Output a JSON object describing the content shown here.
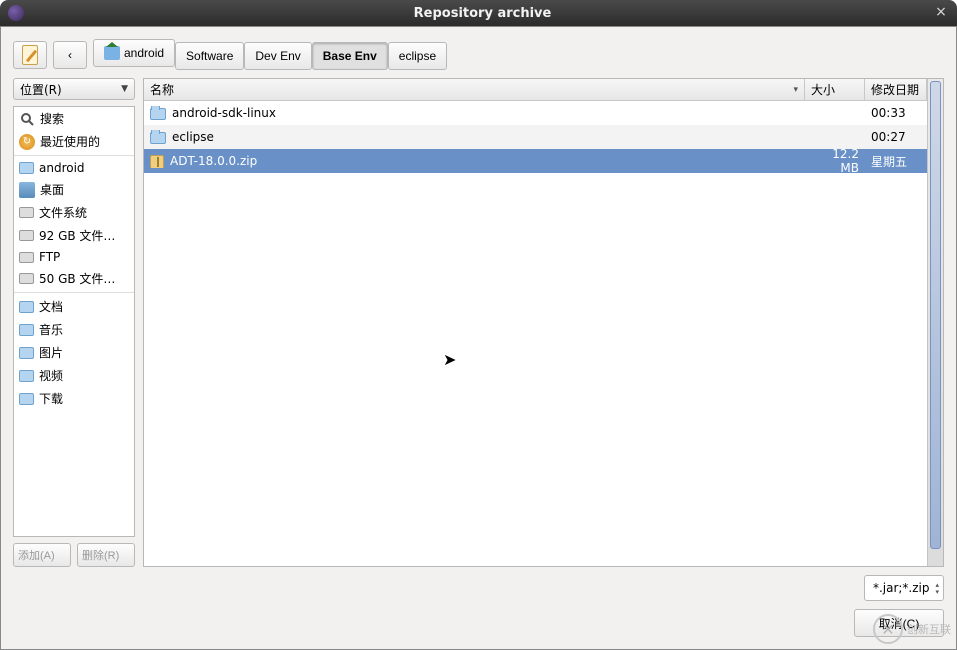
{
  "window": {
    "title": "Repository archive"
  },
  "breadcrumb": {
    "items": [
      {
        "label": "android",
        "is_home": true,
        "active": false
      },
      {
        "label": "Software",
        "active": false
      },
      {
        "label": "Dev Env",
        "active": false
      },
      {
        "label": "Base Env",
        "active": true
      },
      {
        "label": "eclipse",
        "active": false
      }
    ]
  },
  "sidebar": {
    "places_label": "位置(R)",
    "add_label": "添加(A)",
    "remove_label": "删除(R)",
    "group1": [
      {
        "icon": "search",
        "label": "搜索"
      },
      {
        "icon": "recent",
        "label": "最近使用的"
      }
    ],
    "group2": [
      {
        "icon": "folder",
        "label": "android"
      },
      {
        "icon": "desktop",
        "label": "桌面"
      },
      {
        "icon": "drive",
        "label": "文件系统"
      },
      {
        "icon": "drive",
        "label": "92 GB 文件…"
      },
      {
        "icon": "drive",
        "label": "FTP"
      },
      {
        "icon": "drive",
        "label": "50 GB 文件…"
      }
    ],
    "group3": [
      {
        "icon": "folder",
        "label": "文档"
      },
      {
        "icon": "folder",
        "label": "音乐"
      },
      {
        "icon": "folder",
        "label": "图片"
      },
      {
        "icon": "folder",
        "label": "视频"
      },
      {
        "icon": "folder",
        "label": "下载"
      }
    ]
  },
  "columns": {
    "name": "名称",
    "size": "大小",
    "date": "修改日期"
  },
  "files": [
    {
      "type": "folder",
      "name": "android-sdk-linux",
      "size": "",
      "date": "00:33",
      "selected": false
    },
    {
      "type": "folder",
      "name": "eclipse",
      "size": "",
      "date": "00:27",
      "selected": false
    },
    {
      "type": "zip",
      "name": "ADT-18.0.0.zip",
      "size": "12.2 MB",
      "date": "星期五",
      "selected": true
    }
  ],
  "filter": {
    "value": "*.jar;*.zip"
  },
  "actions": {
    "cancel": "取消(C)"
  },
  "watermark": {
    "text": "创新互联"
  }
}
